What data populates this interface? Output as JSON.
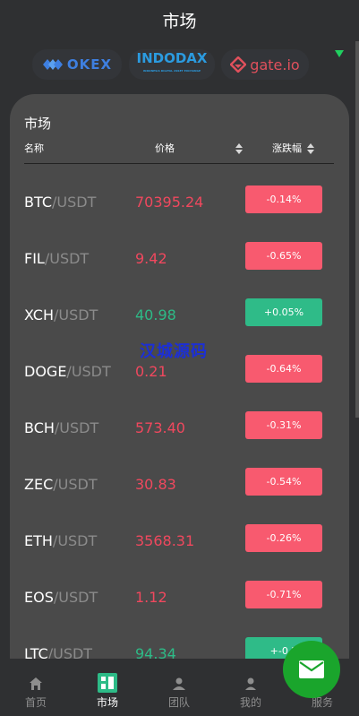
{
  "header": {
    "title": "市场"
  },
  "exchanges": [
    {
      "name": "OKEX",
      "logo": "okex-logo"
    },
    {
      "name": "INDODAX",
      "sub": "INDONESIA DIGITAL ASSET EXCHANGE",
      "logo": "indodax-logo"
    },
    {
      "name": "gate.io",
      "logo": "gate-logo"
    }
  ],
  "market": {
    "title": "市场",
    "columns": {
      "name": "名称",
      "price": "价格",
      "change": "涨跌幅"
    },
    "rows": [
      {
        "base": "BTC",
        "quote": "/USDT",
        "price": "70395.24",
        "change": "-0.14%",
        "dir": "down"
      },
      {
        "base": "FIL",
        "quote": "/USDT",
        "price": "9.42",
        "change": "-0.65%",
        "dir": "down"
      },
      {
        "base": "XCH",
        "quote": "/USDT",
        "price": "40.98",
        "change": "+0.05%",
        "dir": "up"
      },
      {
        "base": "DOGE",
        "quote": "/USDT",
        "price": "0.21",
        "change": "-0.64%",
        "dir": "down"
      },
      {
        "base": "BCH",
        "quote": "/USDT",
        "price": "573.40",
        "change": "-0.31%",
        "dir": "down"
      },
      {
        "base": "ZEC",
        "quote": "/USDT",
        "price": "30.83",
        "change": "-0.54%",
        "dir": "down"
      },
      {
        "base": "ETH",
        "quote": "/USDT",
        "price": "3568.31",
        "change": "-0.26%",
        "dir": "down"
      },
      {
        "base": "EOS",
        "quote": "/USDT",
        "price": "1.12",
        "change": "-0.71%",
        "dir": "down"
      },
      {
        "base": "LTC",
        "quote": "/USDT",
        "price": "94.34",
        "change": "+-0.2",
        "dir": "up"
      }
    ]
  },
  "watermark": "汉城源码",
  "tabs": [
    {
      "label": "首页",
      "icon": "home-icon"
    },
    {
      "label": "市场",
      "icon": "market-icon"
    },
    {
      "label": "团队",
      "icon": "team-icon"
    },
    {
      "label": "我的",
      "icon": "user-icon"
    },
    {
      "label": "服务",
      "icon": "service-icon"
    }
  ],
  "fab": {
    "icon": "mail-icon"
  },
  "colors": {
    "down": "#f0485e",
    "up": "#2dbb87",
    "fab": "#1aa52c"
  }
}
